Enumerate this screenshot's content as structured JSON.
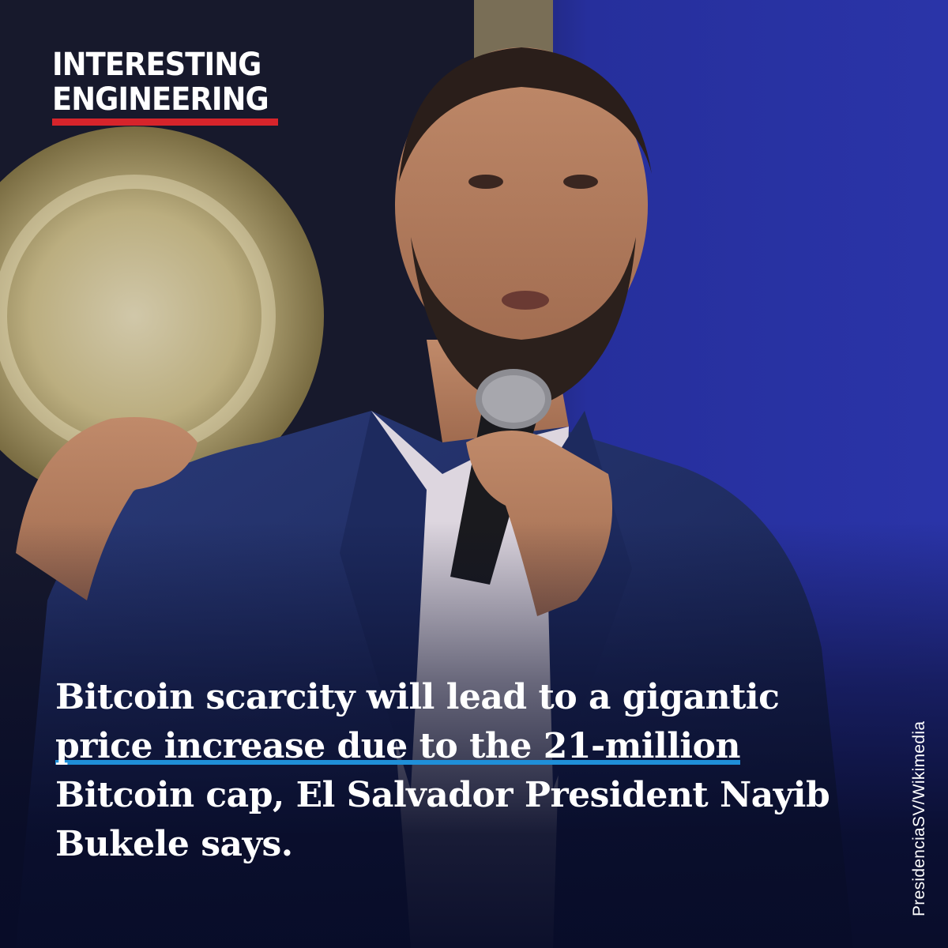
{
  "brand": {
    "line1": "INTERESTING",
    "line2": "ENGINEERING",
    "accent_color": "#d6242b"
  },
  "headline": {
    "line1": "Bitcoin scarcity will lead to a gigantic",
    "line2": "price increase due to the 21-million",
    "line3": "Bitcoin cap, El Salvador President Nayib",
    "line4": "Bukele says.",
    "highlight_color": "#1f8fd8"
  },
  "photo_credit": "PresidenciaSV/Wikimedia"
}
